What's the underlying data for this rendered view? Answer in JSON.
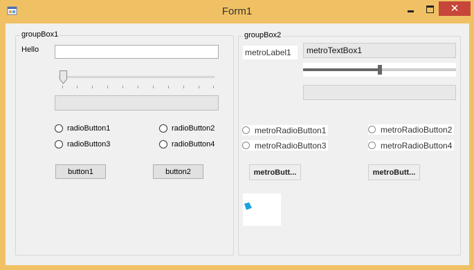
{
  "window": {
    "title": "Form1",
    "controls": {
      "minimize": "minimize",
      "maximize": "maximize",
      "close": "✕"
    }
  },
  "groupBox1": {
    "title": "groupBox1",
    "label": "Hello",
    "textbox_value": "",
    "trackbar_value": 0,
    "progress_value": 0,
    "radios": [
      "radioButton1",
      "radioButton2",
      "radioButton3",
      "radioButton4"
    ],
    "buttons": [
      "button1",
      "button2"
    ]
  },
  "groupBox2": {
    "title": "groupBox2",
    "metro_label": "metroLabel1",
    "metro_textbox_value": "metroTextBox1",
    "metro_trackbar_fraction": 0.5,
    "metro_progress_value": 0,
    "metro_radios": [
      "metroRadioButton1",
      "metroRadioButton2",
      "metroRadioButton3",
      "metroRadioButton4"
    ],
    "metro_buttons": [
      "metroButt...",
      "metroButt..."
    ]
  },
  "colors": {
    "title_bar": "#f0c164",
    "close_button": "#c7463a",
    "spinner_accent": "#1ba1e2"
  }
}
